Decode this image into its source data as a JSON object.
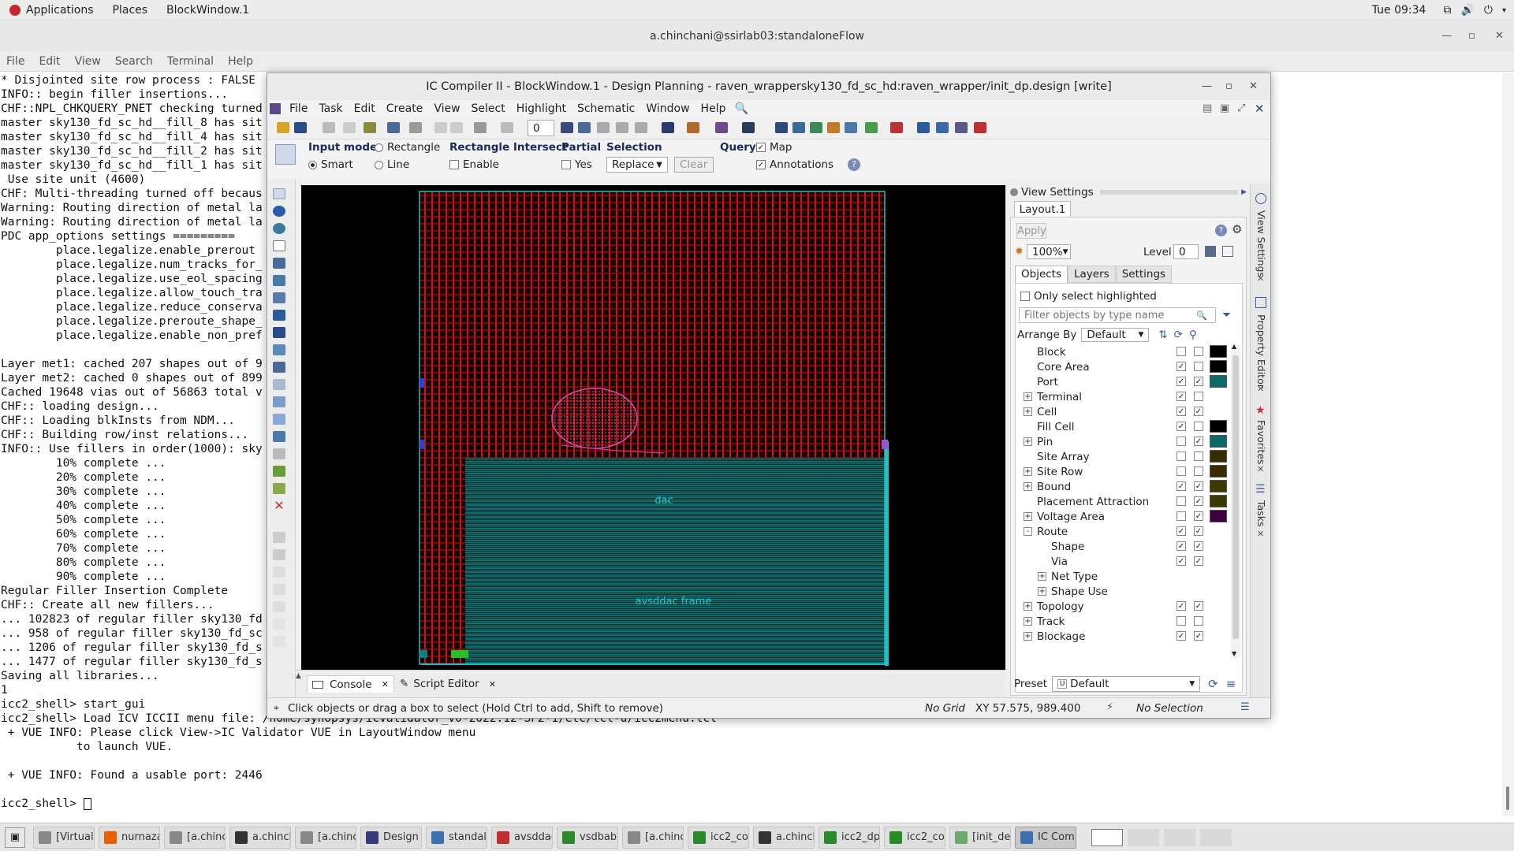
{
  "topbar": {
    "applications": "Applications",
    "places": "Places",
    "active_app": "BlockWindow.1",
    "clock": "Tue 09:34"
  },
  "terminal": {
    "title": "a.chinchani@ssirlab03:standaloneFlow",
    "menu": [
      "File",
      "Edit",
      "View",
      "Search",
      "Terminal",
      "Help"
    ],
    "lines": [
      "* Disjointed site row process : FALSE",
      "INFO:: begin filler insertions...",
      "CHF::NPL_CHKQUERY_PNET checking turned",
      "master sky130_fd_sc_hd__fill_8 has sit",
      "master sky130_fd_sc_hd__fill_4 has sit",
      "master sky130_fd_sc_hd__fill_2 has sit",
      "master sky130_fd_sc_hd__fill_1 has sit",
      " Use site unit (4600)",
      "CHF: Multi-threading turned off becaus",
      "Warning: Routing direction of metal la",
      "Warning: Routing direction of metal la",
      "PDC app_options settings =========",
      "        place.legalize.enable_prerout",
      "        place.legalize.num_tracks_for_",
      "        place.legalize.use_eol_spacing",
      "        place.legalize.allow_touch_tra",
      "        place.legalize.reduce_conserva",
      "        place.legalize.preroute_shape_",
      "        place.legalize.enable_non_pref",
      "",
      "Layer met1: cached 207 shapes out of 9",
      "Layer met2: cached 0 shapes out of 899",
      "Cached 19648 vias out of 56863 total v",
      "CHF:: loading design...",
      "CHF:: Loading blkInsts from NDM...",
      "CHF:: Building row/inst relations...",
      "INFO:: Use fillers in order(1000): sky",
      "        10% complete ...",
      "        20% complete ...",
      "        30% complete ...",
      "        40% complete ...",
      "        50% complete ...",
      "        60% complete ...",
      "        70% complete ...",
      "        80% complete ...",
      "        90% complete ...",
      "Regular Filler Insertion Complete",
      "CHF:: Create all new fillers...",
      "... 102823 of regular filler sky130_fd",
      "... 958 of regular filler sky130_fd_sc",
      "... 1206 of regular filler sky130_fd_s",
      "... 1477 of regular filler sky130_fd_s",
      "Saving all libraries...",
      "1",
      "icc2_shell> start_gui",
      "icc2_shell> Load ICV ICCII menu file: /home/synopsys/icvalidator_v0-2022.12-SP2-1/etc/tcl-u/icc2menu.tcl",
      " + VUE INFO: Please click View->IC Validator VUE in LayoutWindow menu",
      "           to launch VUE.",
      "",
      " + VUE INFO: Found a usable port: 2446",
      "",
      "icc2_shell> "
    ]
  },
  "icc": {
    "title": "IC Compiler II - BlockWindow.1 - Design Planning - raven_wrappersky130_fd_sc_hd:raven_wrapper/init_dp.design [write]",
    "menu": [
      "File",
      "Task",
      "Edit",
      "Create",
      "View",
      "Select",
      "Highlight",
      "Schematic",
      "Window",
      "Help"
    ],
    "toolbar_value": "0",
    "options": {
      "input_mode_label": "Input mode",
      "smart": "Smart",
      "rectangle": "Rectangle",
      "line": "Line",
      "rect_intersect_label": "Rectangle Intersect",
      "enable": "Enable",
      "partial_label": "Partial",
      "yes": "Yes",
      "selection_label": "Selection",
      "selection_value": "Replace",
      "clear": "Clear",
      "query_label": "Query",
      "map": "Map",
      "annotations": "Annotations"
    },
    "canvas": {
      "label_dac": "dac",
      "label_frame": "avsddac frame"
    },
    "view_settings": {
      "header": "View Settings",
      "layout_tab": "Layout.1",
      "apply": "Apply",
      "zoom": "100%",
      "level_label": "Level",
      "level_value": "0",
      "tabs": [
        "Objects",
        "Layers",
        "Settings"
      ],
      "only_highlighted": "Only select highlighted",
      "filter_placeholder": "Filter objects by type name",
      "arrange_by_label": "Arrange By",
      "arrange_by_value": "Default",
      "preset_label": "Preset",
      "preset_value": "Default",
      "tree": [
        {
          "label": "Block",
          "indent": 0,
          "exp": "",
          "v": false,
          "s": false,
          "color": "#000000"
        },
        {
          "label": "Core Area",
          "indent": 0,
          "exp": "",
          "v": true,
          "s": false,
          "color": "#000000"
        },
        {
          "label": "Port",
          "indent": 0,
          "exp": "",
          "v": true,
          "s": true,
          "color": "#0b6b6b"
        },
        {
          "label": "Terminal",
          "indent": 0,
          "exp": "+",
          "v": true,
          "s": false,
          "color": ""
        },
        {
          "label": "Cell",
          "indent": 0,
          "exp": "+",
          "v": true,
          "s": true,
          "color": ""
        },
        {
          "label": "Fill Cell",
          "indent": 0,
          "exp": "",
          "v": true,
          "s": false,
          "color": "#000000"
        },
        {
          "label": "Pin",
          "indent": 0,
          "exp": "+",
          "v": false,
          "s": true,
          "color": "#0b6b6b"
        },
        {
          "label": "Site Array",
          "indent": 0,
          "exp": "",
          "v": false,
          "s": false,
          "color": "#3a2a00"
        },
        {
          "label": "Site Row",
          "indent": 0,
          "exp": "+",
          "v": false,
          "s": false,
          "color": "#3a2a00"
        },
        {
          "label": "Bound",
          "indent": 0,
          "exp": "+",
          "v": true,
          "s": true,
          "color": "#3a3a00"
        },
        {
          "label": "Placement Attraction",
          "indent": 0,
          "exp": "",
          "v": false,
          "s": true,
          "color": "#3a3a00"
        },
        {
          "label": "Voltage Area",
          "indent": 0,
          "exp": "+",
          "v": false,
          "s": true,
          "color": "#400040"
        },
        {
          "label": "Route",
          "indent": 0,
          "exp": "-",
          "v": true,
          "s": true,
          "color": ""
        },
        {
          "label": "Shape",
          "indent": 1,
          "exp": "",
          "v": true,
          "s": true,
          "color": ""
        },
        {
          "label": "Via",
          "indent": 1,
          "exp": "",
          "v": true,
          "s": true,
          "color": ""
        },
        {
          "label": "Net Type",
          "indent": 1,
          "exp": "+",
          "v": null,
          "s": null,
          "color": ""
        },
        {
          "label": "Shape Use",
          "indent": 1,
          "exp": "+",
          "v": null,
          "s": null,
          "color": ""
        },
        {
          "label": "Topology",
          "indent": 0,
          "exp": "+",
          "v": true,
          "s": true,
          "color": ""
        },
        {
          "label": "Track",
          "indent": 0,
          "exp": "+",
          "v": false,
          "s": false,
          "color": ""
        },
        {
          "label": "Blockage",
          "indent": 0,
          "exp": "+",
          "v": true,
          "s": true,
          "color": ""
        }
      ],
      "side_tabs": [
        "View Settings",
        "Property Editor",
        "Favorites",
        "Tasks"
      ]
    },
    "tabs": [
      "Console",
      "Script Editor"
    ],
    "status": {
      "hint": "Click objects or drag a box to select (Hold Ctrl to add, Shift to remove)",
      "grid": "No Grid",
      "xy": "XY 57.575, 989.400",
      "selection": "No Selection"
    }
  },
  "taskbar": [
    {
      "label": "[Virtual ...",
      "color": "#888888"
    },
    {
      "label": "nurnaza...",
      "color": "#e66000"
    },
    {
      "label": "[a.chinc...",
      "color": "#888888"
    },
    {
      "label": "a.chinch...",
      "color": "#333333"
    },
    {
      "label": "[a.chinc...",
      "color": "#888888"
    },
    {
      "label": "Design ...",
      "color": "#3a3a7a"
    },
    {
      "label": "standal...",
      "color": "#3a6fb0"
    },
    {
      "label": "avsddac...",
      "color": "#c03030"
    },
    {
      "label": "vsdbaby...",
      "color": "#2a8a2a"
    },
    {
      "label": "[a.chinc...",
      "color": "#888888"
    },
    {
      "label": "icc2_co...",
      "color": "#2a8a2a"
    },
    {
      "label": "a.chinch...",
      "color": "#333333"
    },
    {
      "label": "icc2_dp...",
      "color": "#2a8a2a"
    },
    {
      "label": "icc2_co...",
      "color": "#2a8a2a"
    },
    {
      "label": "[init_de...",
      "color": "#6aaa6a"
    },
    {
      "label": "IC Com...",
      "color": "#3a6fb0"
    }
  ]
}
